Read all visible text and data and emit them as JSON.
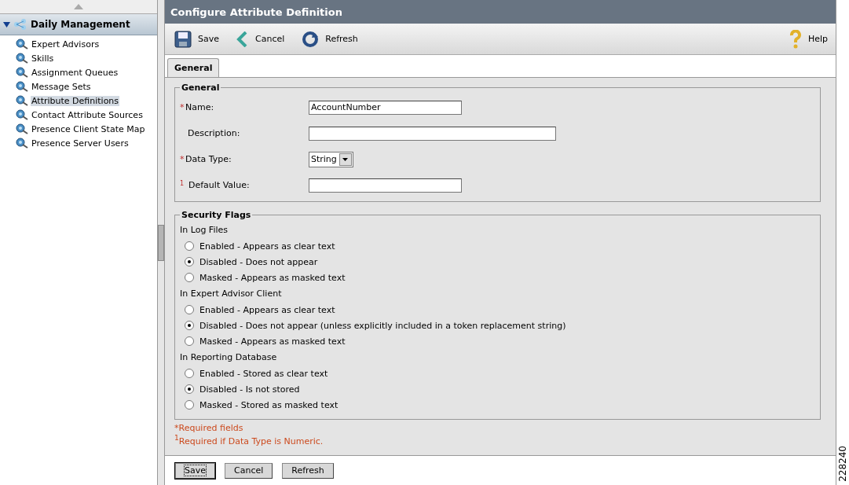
{
  "sidebar": {
    "section": {
      "title": "Daily Management",
      "expanded": true
    },
    "items": [
      {
        "label": "Expert Advisors",
        "selected": false
      },
      {
        "label": "Skills",
        "selected": false
      },
      {
        "label": "Assignment Queues",
        "selected": false
      },
      {
        "label": "Message Sets",
        "selected": false
      },
      {
        "label": "Attribute Definitions",
        "selected": true
      },
      {
        "label": "Contact Attribute Sources",
        "selected": false
      },
      {
        "label": "Presence Client State Map",
        "selected": false
      },
      {
        "label": "Presence Server Users",
        "selected": false
      }
    ]
  },
  "page_title": "Configure Attribute Definition",
  "toolbar": [
    {
      "kind": "save",
      "label": "Save"
    },
    {
      "kind": "cancel",
      "label": "Cancel"
    },
    {
      "kind": "refresh",
      "label": "Refresh"
    },
    {
      "kind": "help",
      "label": "Help"
    }
  ],
  "tabs": [
    {
      "label": "General",
      "selected": true
    }
  ],
  "general": {
    "title": "General",
    "fields": [
      {
        "marker": "*",
        "label": "Name:",
        "kind": "text",
        "value": "AccountNumber",
        "wide": false
      },
      {
        "label": "Description:",
        "kind": "text",
        "wide": true
      },
      {
        "marker": "*",
        "label": "Data Type:",
        "kind": "select",
        "value": "String"
      },
      {
        "marker": "1",
        "label": "Default Value:",
        "kind": "text",
        "wide": false
      }
    ]
  },
  "security_flags": {
    "title": "Security Flags",
    "groups": [
      {
        "title": "In Log Files",
        "options": [
          {
            "label": "Enabled - Appears as clear text",
            "selected": false
          },
          {
            "label": "Disabled - Does not appear",
            "selected": true
          },
          {
            "label": "Masked - Appears as masked text",
            "selected": false
          }
        ]
      },
      {
        "title": "In Expert Advisor Client",
        "options": [
          {
            "label": "Enabled - Appears as clear text",
            "selected": false
          },
          {
            "label": "Disabled - Does not appear (unless explicitly included in a token replacement string)",
            "selected": true
          },
          {
            "label": "Masked - Appears as masked text",
            "selected": false
          }
        ]
      },
      {
        "title": "In Reporting Database",
        "options": [
          {
            "label": "Enabled - Stored as clear text",
            "selected": false
          },
          {
            "label": "Disabled - Is not stored",
            "selected": true
          },
          {
            "label": "Masked - Stored as masked text",
            "selected": false
          }
        ]
      }
    ]
  },
  "notes": [
    "*Required fields",
    "$^{1}$Required if Data Type is Numeric."
  ],
  "buttons": [
    {
      "label": "Save",
      "focused": true
    },
    {
      "label": "Cancel",
      "focused": false
    },
    {
      "label": "Refresh",
      "focused": false
    }
  ],
  "figure_number": "228240"
}
